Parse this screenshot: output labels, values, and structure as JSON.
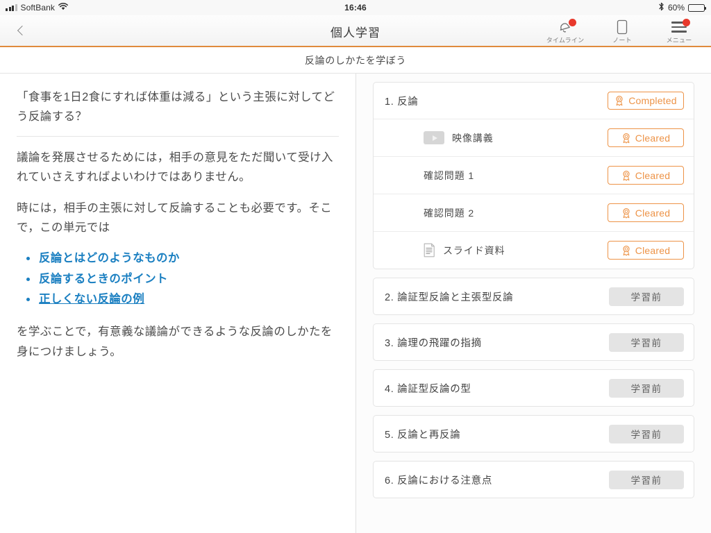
{
  "status_bar": {
    "carrier": "SoftBank",
    "wifi_icon": "wifi-icon",
    "time": "16:46",
    "bluetooth_icon": "bluetooth-icon",
    "battery_percent": "60%",
    "battery_level": 60
  },
  "navbar": {
    "back_icon": "chevron-left-icon",
    "title": "個人学習",
    "actions": [
      {
        "icon": "bell-icon",
        "label": "タイムライン",
        "badge": true
      },
      {
        "icon": "note-icon",
        "label": "ノート",
        "badge": false
      },
      {
        "icon": "menu-icon",
        "label": "メニュー",
        "badge": true
      }
    ]
  },
  "subheader": {
    "title": "反論のしかたを学ぼう"
  },
  "left": {
    "lead": "「食事を1日2食にすれば体重は減る」という主張に対してどう反論する？",
    "paragraph1": "議論を発展させるためには，相手の意見をただ聞いて受け入れていさえすればよいわけではありません。",
    "paragraph2": "時には，相手の主張に対して反論することも必要です。そこで，この単元では",
    "bullets": [
      {
        "text": "反論とはどのようなものか",
        "underlined": false
      },
      {
        "text": "反論するときのポイント",
        "underlined": false
      },
      {
        "text": "正しくない反論の例",
        "underlined": true
      }
    ],
    "paragraph3": "を学ぶことで，有意義な議論ができるような反論のしかたを身につけましょう。"
  },
  "right": {
    "cards": [
      {
        "title": "1. 反論",
        "status": {
          "kind": "completed",
          "label": "Completed",
          "icon": "medal-icon"
        },
        "rows": [
          {
            "icon": "play-icon",
            "label": "映像講義",
            "status": {
              "kind": "cleared",
              "label": "Cleared",
              "icon": "medal-icon"
            }
          },
          {
            "icon": null,
            "label": "確認問題 1",
            "status": {
              "kind": "cleared",
              "label": "Cleared",
              "icon": "medal-icon"
            }
          },
          {
            "icon": null,
            "label": "確認問題 2",
            "status": {
              "kind": "cleared",
              "label": "Cleared",
              "icon": "medal-icon"
            }
          },
          {
            "icon": "document-icon",
            "label": "スライド資料",
            "status": {
              "kind": "cleared",
              "label": "Cleared",
              "icon": "medal-icon"
            }
          }
        ]
      },
      {
        "title": "2. 論証型反論と主張型反論",
        "status": {
          "kind": "locked",
          "label": "学習前"
        },
        "rows": []
      },
      {
        "title": "3. 論理の飛躍の指摘",
        "status": {
          "kind": "locked",
          "label": "学習前"
        },
        "rows": []
      },
      {
        "title": "4. 論証型反論の型",
        "status": {
          "kind": "locked",
          "label": "学習前"
        },
        "rows": []
      },
      {
        "title": "5. 反論と再反論",
        "status": {
          "kind": "locked",
          "label": "学習前"
        },
        "rows": []
      },
      {
        "title": "6. 反論における注意点",
        "status": {
          "kind": "locked",
          "label": "学習前"
        },
        "rows": []
      }
    ]
  },
  "colors": {
    "accent_orange": "#e08a3c",
    "badge_orange": "#ed9347",
    "link_blue": "#1a7fc1",
    "badge_red": "#e8392c",
    "locked_grey": "#e4e4e4"
  }
}
